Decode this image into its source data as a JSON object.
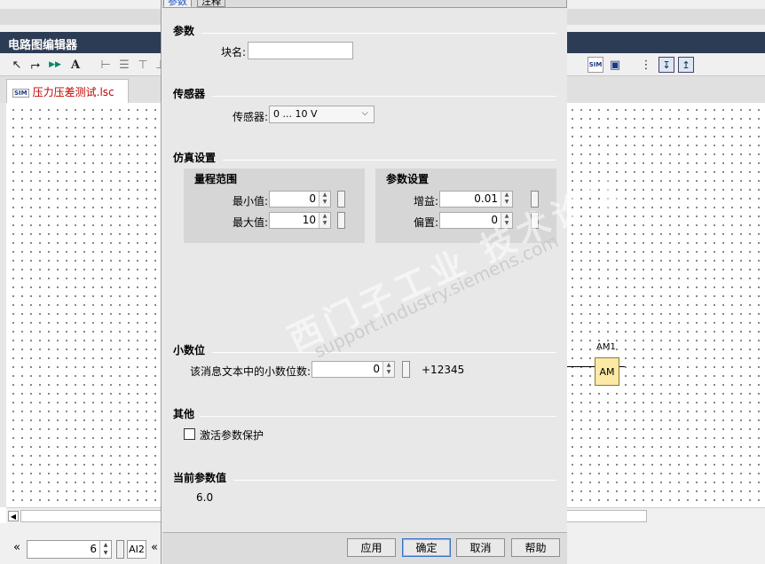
{
  "editor": {
    "title": "电路图编辑器",
    "document_tab": "压力压差测试.lsc",
    "sim_icon_text": "SIM",
    "block_name": "AM1",
    "block_text": "AM"
  },
  "bottom_bar": {
    "prev_label": "«",
    "spin_value": "6",
    "input_label": "AI2",
    "next_label": "«"
  },
  "dialog": {
    "tabs": [
      "参数",
      "注释"
    ],
    "sections": {
      "params": {
        "title": "参数",
        "block_name_label": "块名:",
        "block_name_value": ""
      },
      "sensor": {
        "title": "传感器",
        "sensor_label": "传感器:",
        "sensor_value": "0 ... 10 V"
      },
      "simulation": {
        "title": "仿真设置",
        "range_group": {
          "title": "量程范围",
          "min_label": "最小值:",
          "min_value": "0",
          "max_label": "最大值:",
          "max_value": "10"
        },
        "param_group": {
          "title": "参数设置",
          "gain_label": "增益:",
          "gain_value": "0.01",
          "offset_label": "偏置:",
          "offset_value": "0"
        }
      },
      "decimal": {
        "title": "小数位",
        "decimals_label": "该消息文本中的小数位数:",
        "decimals_value": "0",
        "preview": "+12345"
      },
      "other": {
        "title": "其他",
        "protect_label": "激活参数保护",
        "protect_checked": false
      },
      "current": {
        "title": "当前参数值",
        "value": "6.0"
      }
    },
    "buttons": {
      "apply": "应用",
      "ok": "确定",
      "cancel": "取消",
      "help": "帮助"
    }
  },
  "watermark": {
    "cn": "西门子工业 技术论坛",
    "url": "support.industry.siemens.com"
  }
}
